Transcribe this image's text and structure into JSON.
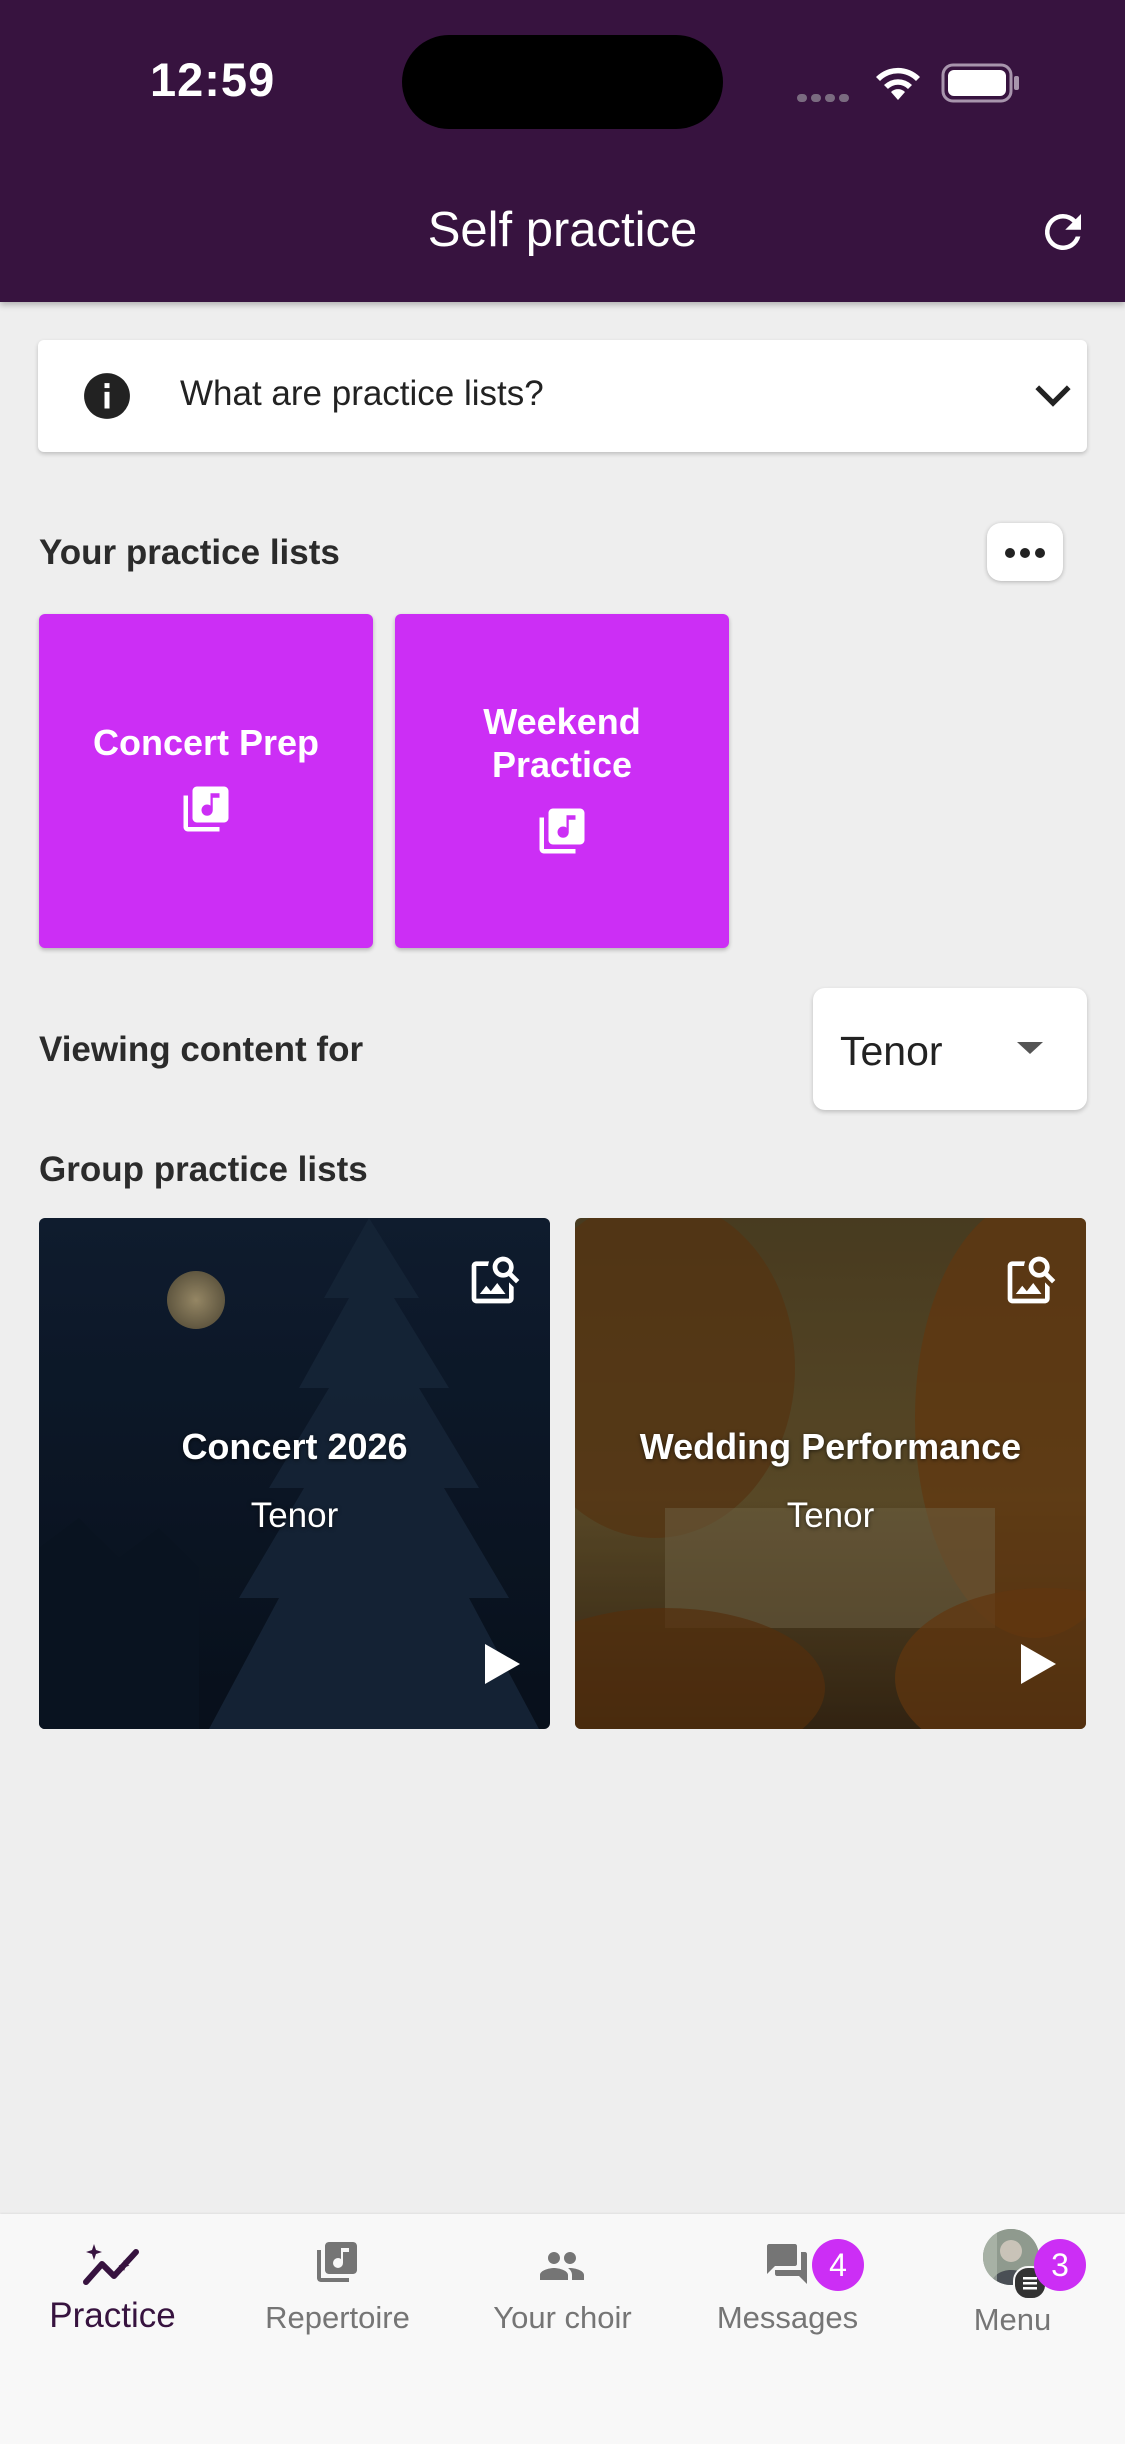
{
  "status_bar": {
    "time": "12:59"
  },
  "header": {
    "title": "Self practice"
  },
  "info_panel": {
    "label": "What are practice lists?"
  },
  "your_lists": {
    "heading": "Your practice lists",
    "items": [
      {
        "title": "Concert Prep"
      },
      {
        "title_line1": "Weekend",
        "title_line2": "Practice"
      }
    ]
  },
  "viewing": {
    "label": "Viewing content for",
    "selected_voice": "Tenor"
  },
  "group_lists": {
    "heading": "Group practice lists",
    "items": [
      {
        "title": "Concert 2026",
        "voice": "Tenor"
      },
      {
        "title": "Wedding Performance",
        "voice": "Tenor"
      }
    ]
  },
  "bottom_nav": {
    "items": [
      {
        "label": "Practice",
        "icon": "practice-sparkline-icon",
        "active": true
      },
      {
        "label": "Repertoire",
        "icon": "music-library-icon"
      },
      {
        "label": "Your choir",
        "icon": "people-icon"
      },
      {
        "label": "Messages",
        "icon": "chat-icon",
        "badge": "4"
      },
      {
        "label": "Menu",
        "icon": "avatar",
        "badge": "3"
      }
    ]
  },
  "colors": {
    "header_bg": "#37133f",
    "accent": "#cc2ef5",
    "background": "#eeeeee"
  }
}
